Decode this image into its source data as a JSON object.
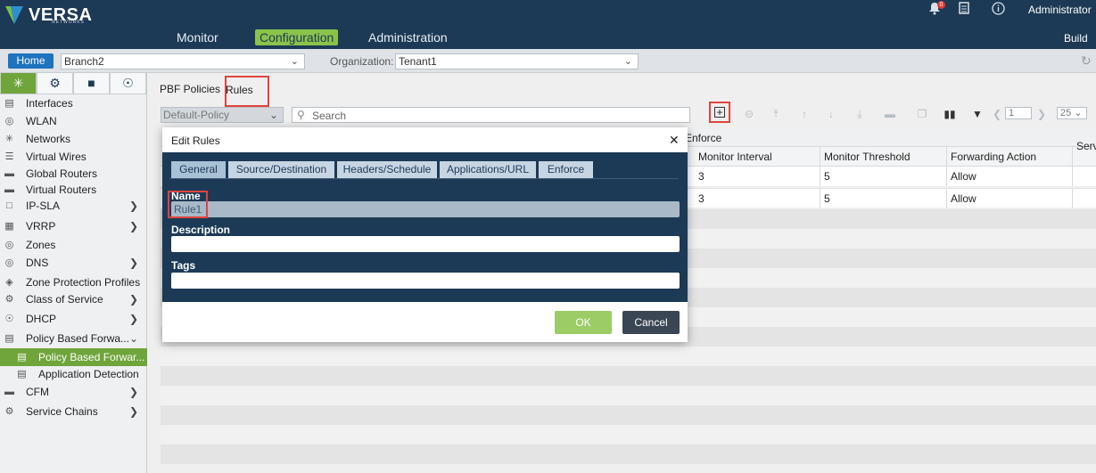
{
  "header": {
    "brand": "VERSA",
    "brand_sub": "NETWORKS",
    "nav": [
      "Monitor",
      "Configuration",
      "Administration"
    ],
    "active_nav": "Configuration",
    "notification_count": "0",
    "user": "Administrator",
    "build": "Build"
  },
  "context_bar": {
    "home": "Home",
    "appliance": "Branch2",
    "org_label": "Organization:",
    "org": "Tenant1"
  },
  "sidebar": {
    "tabs": [
      "network-icon",
      "gear-icon",
      "cube-icon",
      "globe-gear-icon"
    ],
    "items": [
      {
        "label": "Interfaces",
        "icon": "interfaces-icon"
      },
      {
        "label": "WLAN",
        "icon": "wlan-icon"
      },
      {
        "label": "Networks",
        "icon": "networks-icon"
      },
      {
        "label": "Virtual Wires",
        "icon": "virtual-wires-icon"
      },
      {
        "label": "Global Routers",
        "icon": "router-icon"
      },
      {
        "label": "Virtual Routers",
        "icon": "router-icon"
      },
      {
        "label": "IP-SLA",
        "icon": "ipsla-icon"
      },
      {
        "label": "VRRP",
        "icon": "vrrp-icon"
      },
      {
        "label": "Zones",
        "icon": "zones-icon"
      },
      {
        "label": "DNS",
        "icon": "dns-icon"
      },
      {
        "label": "Zone Protection Profiles",
        "icon": "zone-protection-icon"
      },
      {
        "label": "Class of Service",
        "icon": "cos-icon"
      },
      {
        "label": "DHCP",
        "icon": "dhcp-icon"
      },
      {
        "label": "Policy Based Forwa...",
        "icon": "pbf-icon"
      },
      {
        "label": "Policy Based Forwar...",
        "icon": "pbf-icon"
      },
      {
        "label": "Application Detection",
        "icon": "app-detect-icon"
      },
      {
        "label": "CFM",
        "icon": "cfm-icon"
      },
      {
        "label": "Service Chains",
        "icon": "service-chain-icon"
      }
    ]
  },
  "main": {
    "tabs": [
      "PBF Policies",
      "Rules"
    ],
    "active_tab": "Rules",
    "policy": "Default-Policy",
    "search_placeholder": "Search",
    "page": "1",
    "page_size": "25",
    "group_header": "Enforce",
    "columns": [
      "Monitor Interval",
      "Monitor Threshold",
      "Forwarding Action",
      "Serv"
    ],
    "rows": [
      [
        "3",
        "5",
        "Allow"
      ],
      [
        "3",
        "5",
        "Allow"
      ]
    ]
  },
  "modal": {
    "title": "Edit Rules",
    "tabs": [
      "General",
      "Source/Destination",
      "Headers/Schedule",
      "Applications/URL",
      "Enforce"
    ],
    "active_tab": "General",
    "name_label": "Name",
    "name_value": "Rule1",
    "description_label": "Description",
    "description_value": "",
    "tags_label": "Tags",
    "tags_value": "",
    "ok": "OK",
    "cancel": "Cancel"
  },
  "colors": {
    "header_bg": "#1c3a56",
    "accent_green": "#8bc34a",
    "highlight_red": "#e0443e",
    "home_blue": "#1e73be"
  }
}
